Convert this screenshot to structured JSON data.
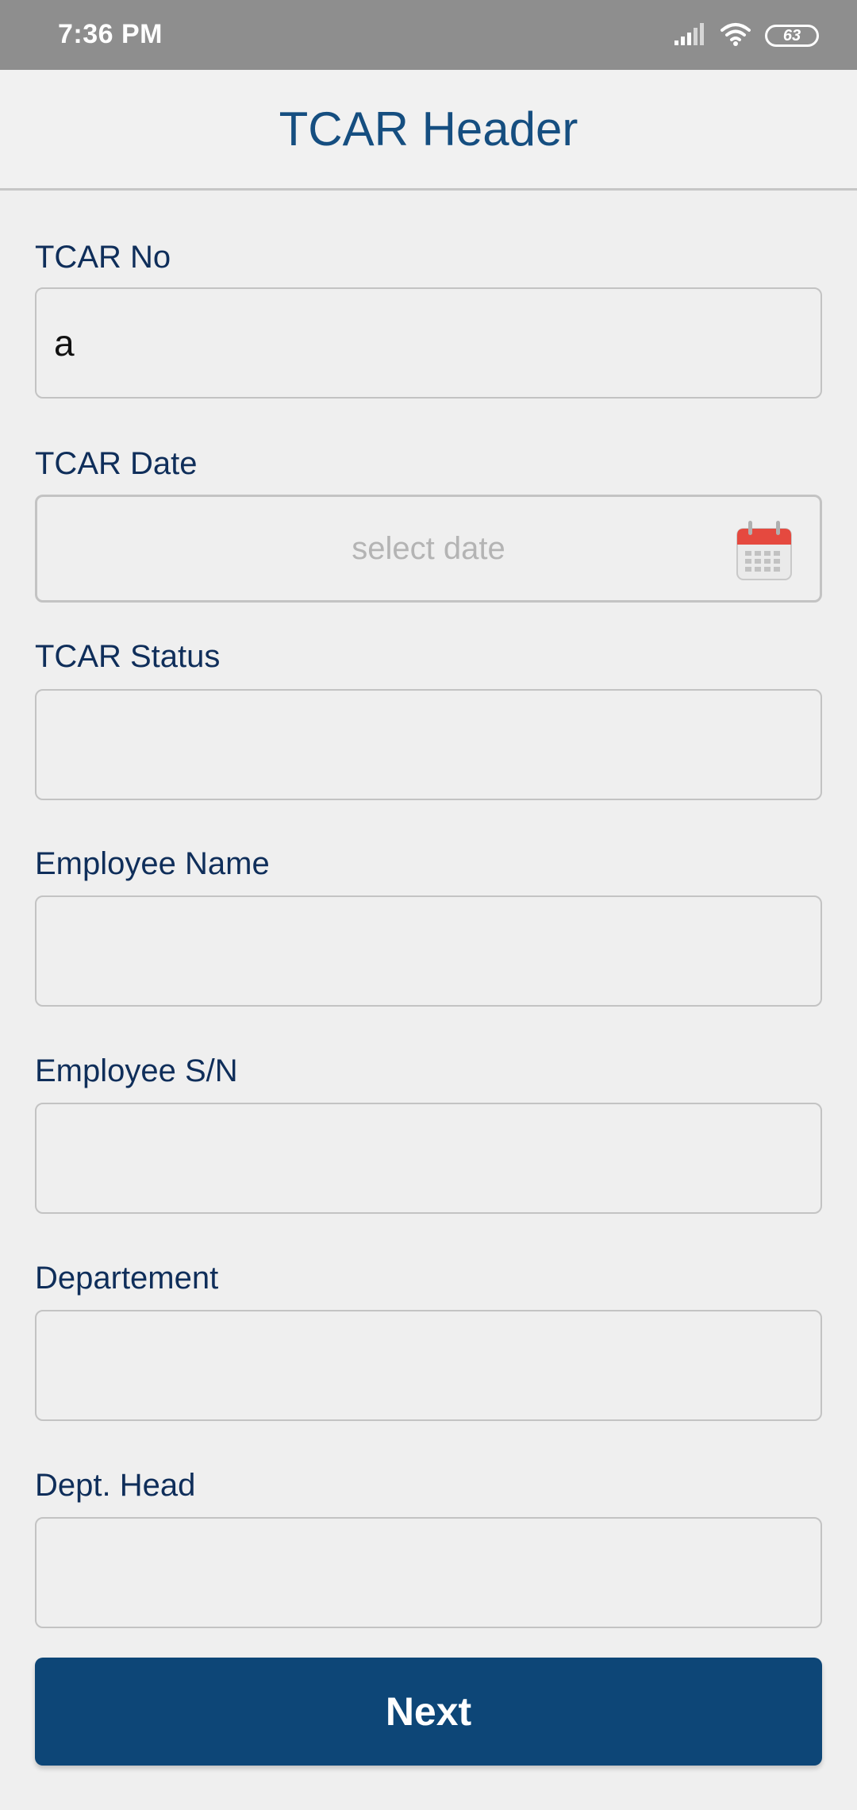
{
  "status_bar": {
    "time": "7:36 PM",
    "battery": "63",
    "icons": [
      "signal-icon",
      "wifi-icon",
      "battery-icon"
    ]
  },
  "header": {
    "title": "TCAR Header"
  },
  "form": {
    "tcar_no": {
      "label": "TCAR No",
      "value": "a"
    },
    "tcar_date": {
      "label": "TCAR Date",
      "placeholder": "select date",
      "icon": "calendar-icon"
    },
    "tcar_status": {
      "label": "TCAR Status",
      "value": ""
    },
    "employee_name": {
      "label": "Employee Name",
      "value": ""
    },
    "employee_sn": {
      "label": "Employee S/N",
      "value": ""
    },
    "departement": {
      "label": "Departement",
      "value": ""
    },
    "dept_head": {
      "label": "Dept. Head",
      "value": ""
    }
  },
  "actions": {
    "next_label": "Next"
  },
  "colors": {
    "primary": "#0d4677",
    "title": "#154e80",
    "label": "#0f2e5a",
    "status_bar": "#8e8e8e",
    "calendar_red": "#e5493f"
  }
}
